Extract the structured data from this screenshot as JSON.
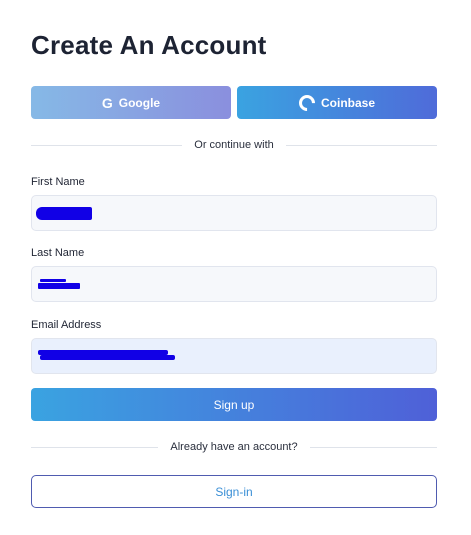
{
  "page": {
    "title": "Create An Account"
  },
  "oauth": {
    "google_label": "Google",
    "coinbase_label": "Coinbase"
  },
  "divider_top": {
    "text": "Or continue with"
  },
  "form": {
    "first_name": {
      "label": "First Name",
      "value": ""
    },
    "last_name": {
      "label": "Last Name",
      "value": ""
    },
    "email": {
      "label": "Email Address",
      "value": ""
    }
  },
  "actions": {
    "signup_label": "Sign up",
    "signin_label": "Sign-in"
  },
  "divider_bottom": {
    "text": "Already have an account?"
  },
  "colors": {
    "primary_gradient_start": "#3aa3e1",
    "primary_gradient_end": "#4f60d8",
    "redaction": "#1100e6",
    "title": "#1d2333"
  }
}
